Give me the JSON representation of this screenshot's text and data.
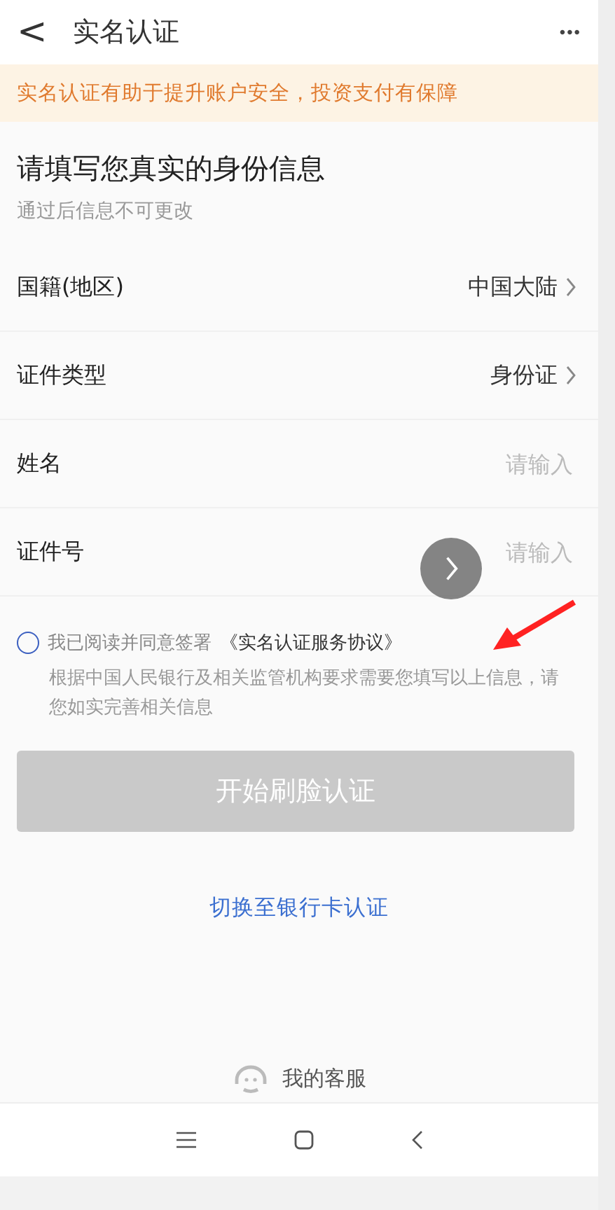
{
  "header": {
    "back": "<",
    "title": "实名认证",
    "more": "•••"
  },
  "banner": "实名认证有助于提升账户安全，投资支付有保障",
  "intro": {
    "heading": "请填写您真实的身份信息",
    "subheading": "通过后信息不可更改"
  },
  "fields": [
    {
      "kind": "select",
      "label": "国籍(地区)",
      "value": "中国大陆"
    },
    {
      "kind": "select",
      "label": "证件类型",
      "value": "身份证"
    },
    {
      "kind": "input",
      "label": "姓名",
      "placeholder": "请输入"
    },
    {
      "kind": "input",
      "label": "证件号",
      "placeholder": "请输入"
    }
  ],
  "agreement": {
    "checked": false,
    "text": "我已阅读并同意签署",
    "link": "《实名认证服务协议》",
    "note": "根据中国人民银行及相关监管机构要求需要您填写以上信息，请您如实完善相关信息"
  },
  "submit": {
    "label": "开始刷脸认证",
    "disabled": true
  },
  "switch_link": "切换至银行卡认证",
  "service": "我的客服",
  "nav": [
    {
      "kind": "menu"
    },
    {
      "kind": "home"
    },
    {
      "kind": "back"
    }
  ]
}
